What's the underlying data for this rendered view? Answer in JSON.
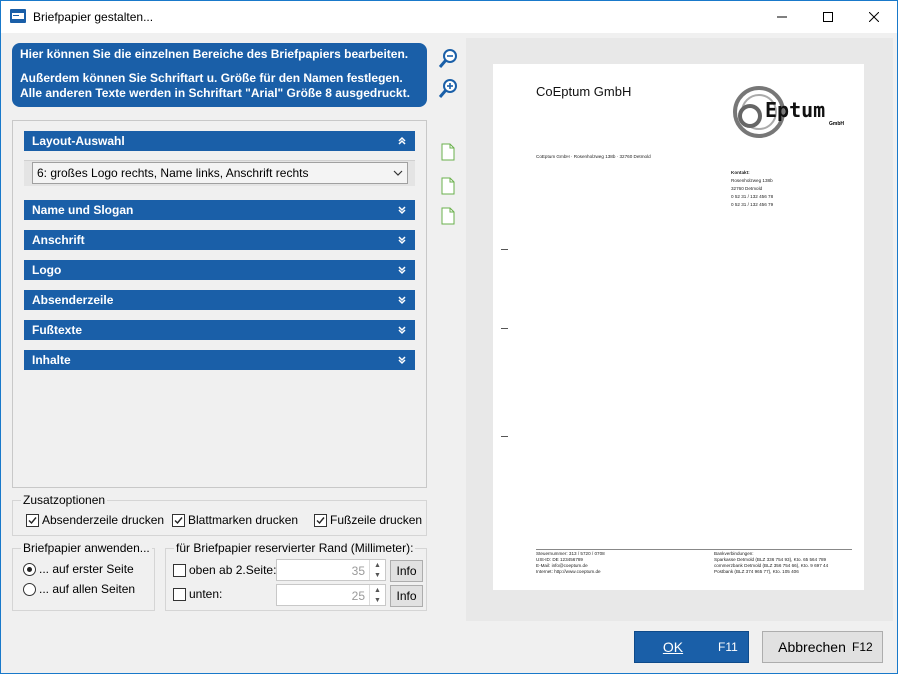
{
  "window": {
    "title": "Briefpapier gestalten..."
  },
  "info": {
    "line1": "Hier können Sie die einzelnen Bereiche des Briefpapiers bearbeiten.",
    "line2": "Außerdem können Sie Schriftart u. Größe für den Namen festlegen.",
    "line3": "Alle anderen Texte werden in Schriftart \"Arial\" Größe 8 ausgedruckt."
  },
  "sections": {
    "layout": "Layout-Auswahl",
    "layout_value": "6: großes Logo rechts, Name links, Anschrift rechts",
    "name": "Name und Slogan",
    "anschrift": "Anschrift",
    "logo": "Logo",
    "absender": "Absenderzeile",
    "fuss": "Fußtexte",
    "inhalte": "Inhalte"
  },
  "zusatz": {
    "label": "Zusatzoptionen",
    "absender": "Absenderzeile drucken",
    "blatt": "Blattmarken drucken",
    "fuss": "Fußzeile drucken"
  },
  "anwenden": {
    "label": "Briefpapier anwenden...",
    "erste": "... auf erster Seite",
    "alle": "... auf allen Seiten"
  },
  "rand": {
    "label": "für Briefpapier reservierter Rand (Millimeter):",
    "oben": "oben ab 2.Seite:",
    "oben_val": "35",
    "unten": "unten:",
    "unten_val": "25",
    "info": "Info"
  },
  "preview": {
    "company": "CoEptum GmbH",
    "logo_text": "Eptum",
    "logo_sub": "GmbH",
    "sender_line": "CoEptum GmbH · Rosenholzweg 138b · 32760 Detmold",
    "contact_head": "Kontakt:",
    "contact_1": "Rosenholzweg 138b",
    "contact_2": "32760 Detmold",
    "contact_3": "0 52 31 / 132 456 78",
    "contact_4": "0 52 31 / 132 456 79",
    "foot_l1": "Steuernummer: 313 / 5720 / 0708",
    "foot_l2": "USt-ID: DE 123456789",
    "foot_l3": "E-Mail: info@coeptum.de",
    "foot_l4": "Internet: http://www.coeptum.de",
    "foot_r1": "Bankverbindungen:",
    "foot_r2": "Sparkasse Detmold (BLZ 336 754 93), Kto. 65 564 789",
    "foot_r3": "commerzbank Detmold (BLZ 356 754 66), Kto. 9 697 44",
    "foot_r4": "Postbank (BLZ 374 965 77), Kto. 105 406"
  },
  "buttons": {
    "ok": "OK",
    "ok_key": "F11",
    "cancel": "Abbrechen",
    "cancel_key": "F12"
  }
}
